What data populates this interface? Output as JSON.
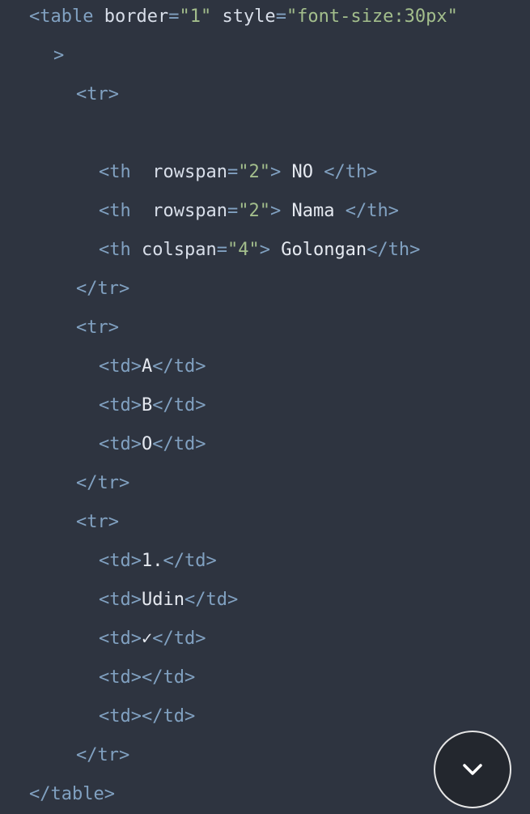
{
  "code": {
    "language": "html",
    "lines": [
      [
        {
          "t": "tag",
          "v": "<table"
        },
        {
          "t": "attr",
          "v": " border"
        },
        {
          "t": "eq",
          "v": "="
        },
        {
          "t": "str",
          "v": "\"1\""
        },
        {
          "t": "attr",
          "v": " style"
        },
        {
          "t": "eq",
          "v": "="
        },
        {
          "t": "str",
          "v": "\"font-size:30px\""
        }
      ],
      [
        {
          "t": "tag",
          "v": ">"
        }
      ],
      [
        {
          "t": "tag",
          "v": "<tr>"
        }
      ],
      [],
      [
        {
          "t": "tag",
          "v": "<th"
        },
        {
          "t": "attr",
          "v": "  rowspan"
        },
        {
          "t": "eq",
          "v": "="
        },
        {
          "t": "str",
          "v": "\"2\""
        },
        {
          "t": "tag",
          "v": ">"
        },
        {
          "t": "text",
          "v": " NO "
        },
        {
          "t": "tag",
          "v": "</th>"
        }
      ],
      [
        {
          "t": "tag",
          "v": "<th"
        },
        {
          "t": "attr",
          "v": "  rowspan"
        },
        {
          "t": "eq",
          "v": "="
        },
        {
          "t": "str",
          "v": "\"2\""
        },
        {
          "t": "tag",
          "v": ">"
        },
        {
          "t": "text",
          "v": " Nama "
        },
        {
          "t": "tag",
          "v": "</th>"
        }
      ],
      [
        {
          "t": "tag",
          "v": "<th"
        },
        {
          "t": "attr",
          "v": " colspan"
        },
        {
          "t": "eq",
          "v": "="
        },
        {
          "t": "str",
          "v": "\"4\""
        },
        {
          "t": "tag",
          "v": ">"
        },
        {
          "t": "text",
          "v": " Golongan"
        },
        {
          "t": "tag",
          "v": "</th>"
        }
      ],
      [
        {
          "t": "tag",
          "v": "</tr>"
        }
      ],
      [
        {
          "t": "tag",
          "v": "<tr>"
        }
      ],
      [
        {
          "t": "tag",
          "v": "<td>"
        },
        {
          "t": "text",
          "v": "A"
        },
        {
          "t": "tag",
          "v": "</td>"
        }
      ],
      [
        {
          "t": "tag",
          "v": "<td>"
        },
        {
          "t": "text",
          "v": "B"
        },
        {
          "t": "tag",
          "v": "</td>"
        }
      ],
      [
        {
          "t": "tag",
          "v": "<td>"
        },
        {
          "t": "text",
          "v": "O"
        },
        {
          "t": "tag",
          "v": "</td>"
        }
      ],
      [
        {
          "t": "tag",
          "v": "</tr>"
        }
      ],
      [
        {
          "t": "tag",
          "v": "<tr>"
        }
      ],
      [
        {
          "t": "tag",
          "v": "<td>"
        },
        {
          "t": "text",
          "v": "1."
        },
        {
          "t": "tag",
          "v": "</td>"
        }
      ],
      [
        {
          "t": "tag",
          "v": "<td>"
        },
        {
          "t": "text",
          "v": "Udin"
        },
        {
          "t": "tag",
          "v": "</td>"
        }
      ],
      [
        {
          "t": "tag",
          "v": "<td>"
        },
        {
          "t": "text",
          "v": "✓"
        },
        {
          "t": "tag",
          "v": "</td>"
        }
      ],
      [
        {
          "t": "tag",
          "v": "<td>"
        },
        {
          "t": "tag",
          "v": "</td>"
        }
      ],
      [
        {
          "t": "tag",
          "v": "<td>"
        },
        {
          "t": "tag",
          "v": "</td>"
        }
      ],
      [
        {
          "t": "tag",
          "v": "</tr>"
        }
      ],
      [
        {
          "t": "tag",
          "v": "</table>"
        }
      ]
    ]
  },
  "scroll_button": {
    "icon": "chevron-down-icon"
  },
  "colors": {
    "background": "#2e3440",
    "tag": "#81a1c1",
    "attribute": "#d8dee9",
    "string": "#a3be8c",
    "text": "#e5e9f0",
    "button_bg": "#23272e",
    "button_border": "#e6e6e6"
  }
}
